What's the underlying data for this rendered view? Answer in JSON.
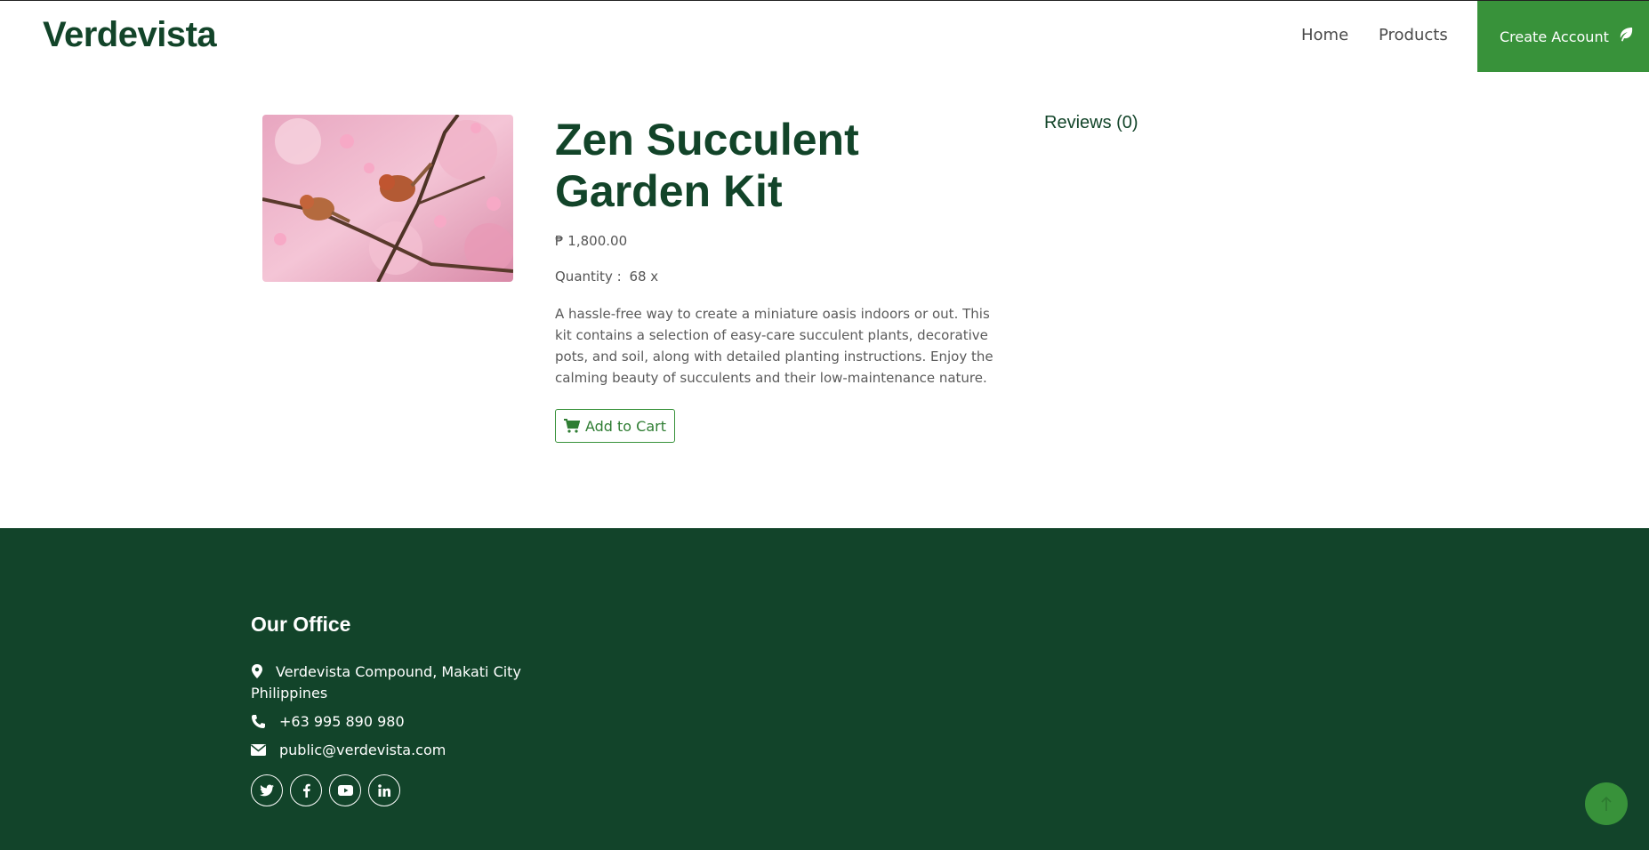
{
  "brand": {
    "name": "Verdevista"
  },
  "nav": {
    "home_label": "Home",
    "products_label": "Products",
    "create_account_label": "Create Account"
  },
  "product": {
    "title": "Zen Succulent Garden Kit",
    "price": "₱ 1,800.00",
    "quantity_label": "Quantity :",
    "quantity_value": "68 x",
    "description": "A hassle-free way to create a miniature oasis indoors or out. This kit contains a selection of easy-care succulent plants, decorative pots, and soil, along with detailed planting instructions. Enjoy the calming beauty of succulents and their low-maintenance nature.",
    "add_to_cart_label": "Add to Cart",
    "image_subject": "birds on pink blossom branch"
  },
  "reviews": {
    "label": "Reviews (0)"
  },
  "footer": {
    "office_title": "Our Office",
    "address_line1": "Verdevista Compound, Makati City",
    "address_line2": "Philippines",
    "phone": "+63 995 890 980",
    "email": "public@verdevista.com",
    "socials": [
      "twitter-icon",
      "facebook-icon",
      "youtube-icon",
      "linkedin-icon"
    ]
  },
  "colors": {
    "brand_dark": "#124429",
    "accent_green": "#38923a",
    "footer_bg": "#12442a"
  }
}
